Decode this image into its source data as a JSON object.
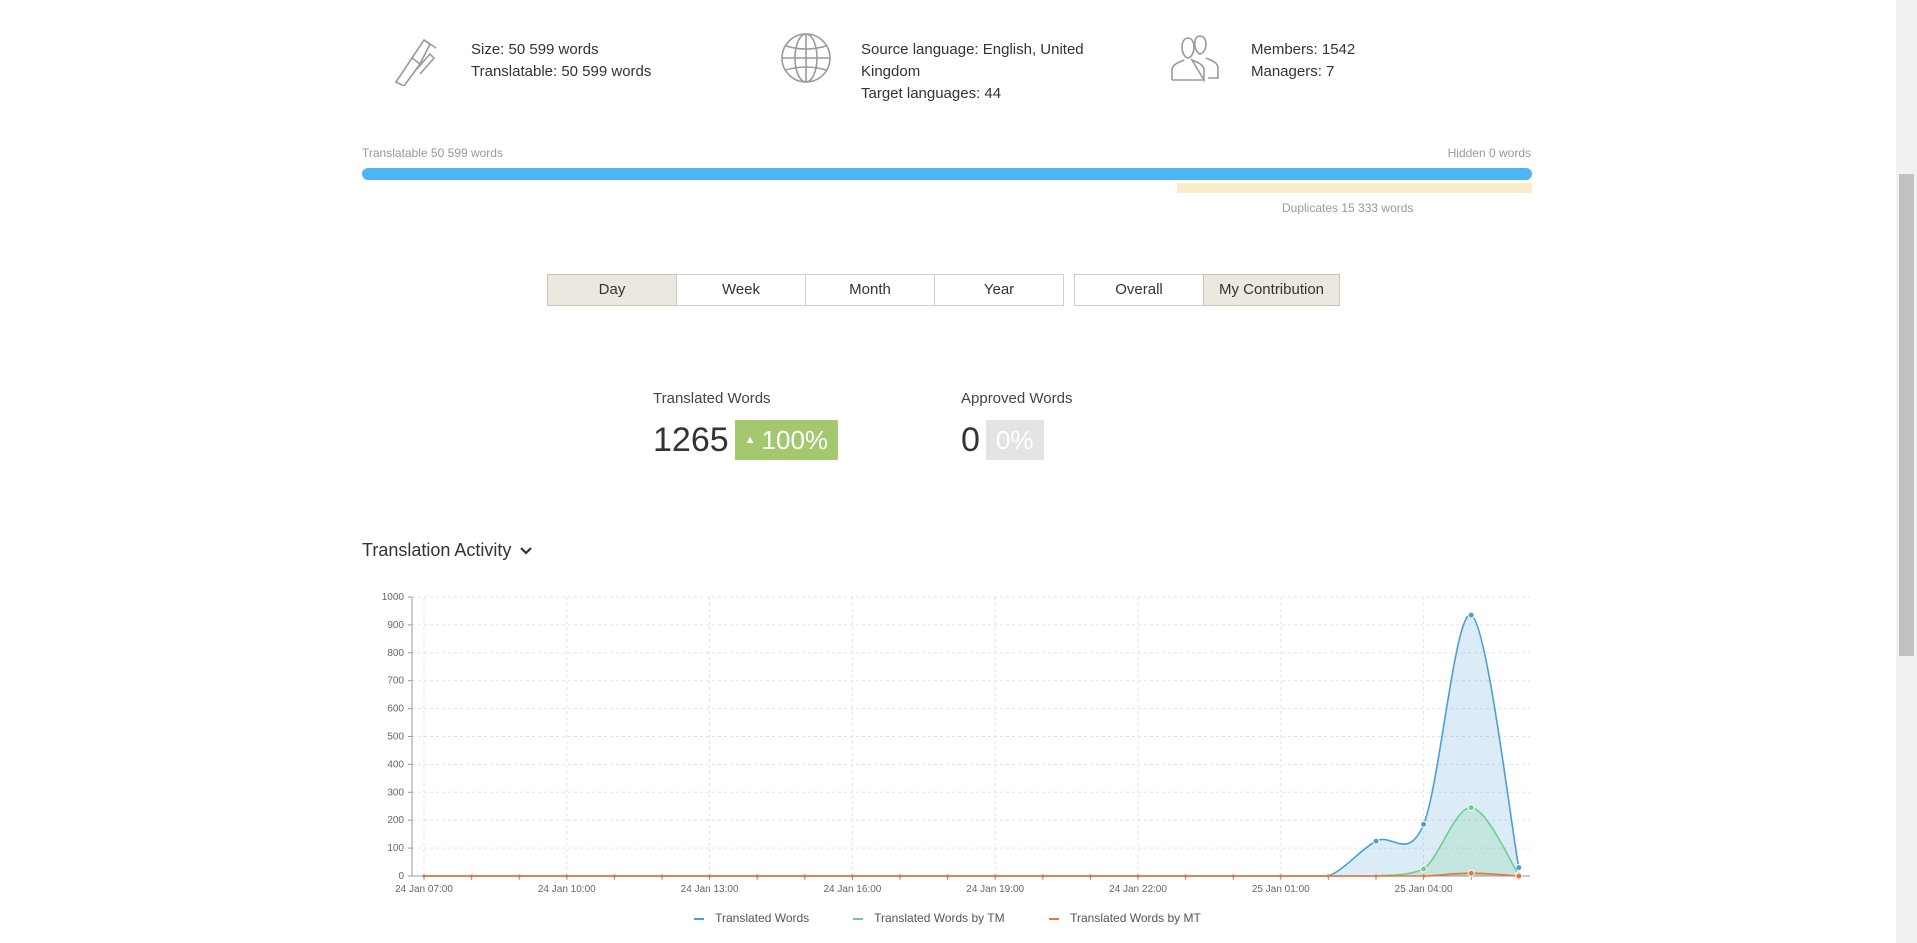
{
  "summary": {
    "size": {
      "icon": "caliper-icon",
      "size_text": "Size: 50 599 words",
      "translatable_text": "Translatable: 50 599 words"
    },
    "languages": {
      "icon": "globe-icon",
      "source_line1": "Source language: English, United",
      "source_line2": "Kingdom",
      "target_text": "Target languages: 44"
    },
    "members": {
      "icon": "people-icon",
      "members_text": "Members: 1542",
      "managers_text": "Managers: 7"
    }
  },
  "progress": {
    "translatable_label": "Translatable 50 599 words",
    "hidden_label": "Hidden 0 words",
    "duplicates_label": "Duplicates 15 333 words",
    "translatable_fraction": 1.0,
    "duplicates_fraction": 0.303,
    "colors": {
      "main": "#4db5f5",
      "duplicates": "#fbeccb"
    }
  },
  "period_buttons": [
    {
      "label": "Day",
      "active": true
    },
    {
      "label": "Week",
      "active": false
    },
    {
      "label": "Month",
      "active": false
    },
    {
      "label": "Year",
      "active": false
    }
  ],
  "scope_buttons": [
    {
      "label": "Overall",
      "active": false
    },
    {
      "label": "My Contribution",
      "active": true
    }
  ],
  "stats": {
    "translated": {
      "label": "Translated Words",
      "value": "1265",
      "arrow": "▲",
      "change": "100%"
    },
    "approved": {
      "label": "Approved Words",
      "value": "0",
      "change": "0%"
    }
  },
  "activity": {
    "title": "Translation Activity",
    "toggle_icon": "chevron-down-icon"
  },
  "chart_data": {
    "type": "area",
    "ylim": [
      0,
      1000
    ],
    "y_ticks": [
      0,
      100,
      200,
      300,
      400,
      500,
      600,
      700,
      800,
      900,
      1000
    ],
    "x_tick_labels": [
      "24 Jan 07:00",
      "24 Jan 10:00",
      "24 Jan 13:00",
      "24 Jan 16:00",
      "24 Jan 19:00",
      "24 Jan 22:00",
      "25 Jan 01:00",
      "25 Jan 04:00"
    ],
    "x": [
      "24 Jan 07:00",
      "24 Jan 08:00",
      "24 Jan 09:00",
      "24 Jan 10:00",
      "24 Jan 11:00",
      "24 Jan 12:00",
      "24 Jan 13:00",
      "24 Jan 14:00",
      "24 Jan 15:00",
      "24 Jan 16:00",
      "24 Jan 17:00",
      "24 Jan 18:00",
      "24 Jan 19:00",
      "24 Jan 20:00",
      "24 Jan 21:00",
      "24 Jan 22:00",
      "24 Jan 23:00",
      "25 Jan 00:00",
      "25 Jan 01:00",
      "25 Jan 02:00",
      "25 Jan 03:00",
      "25 Jan 04:00",
      "25 Jan 05:00",
      "25 Jan 06:00"
    ],
    "series": [
      {
        "name": "Translated Words",
        "color": "#4a9fd8",
        "values": [
          0,
          0,
          0,
          0,
          0,
          0,
          0,
          0,
          0,
          0,
          0,
          0,
          0,
          0,
          0,
          0,
          0,
          0,
          0,
          0,
          125,
          185,
          935,
          30
        ]
      },
      {
        "name": "Translated Words by TM",
        "color": "#6fcf8a",
        "values": [
          0,
          0,
          0,
          0,
          0,
          0,
          0,
          0,
          0,
          0,
          0,
          0,
          0,
          0,
          0,
          0,
          0,
          0,
          0,
          0,
          0,
          25,
          245,
          5
        ]
      },
      {
        "name": "Translated Words by MT",
        "color": "#e8743b",
        "values": [
          0,
          0,
          0,
          0,
          0,
          0,
          0,
          0,
          0,
          0,
          0,
          0,
          0,
          0,
          0,
          0,
          0,
          0,
          0,
          0,
          0,
          0,
          10,
          0
        ]
      }
    ],
    "grid": true,
    "legend": "bottom"
  }
}
